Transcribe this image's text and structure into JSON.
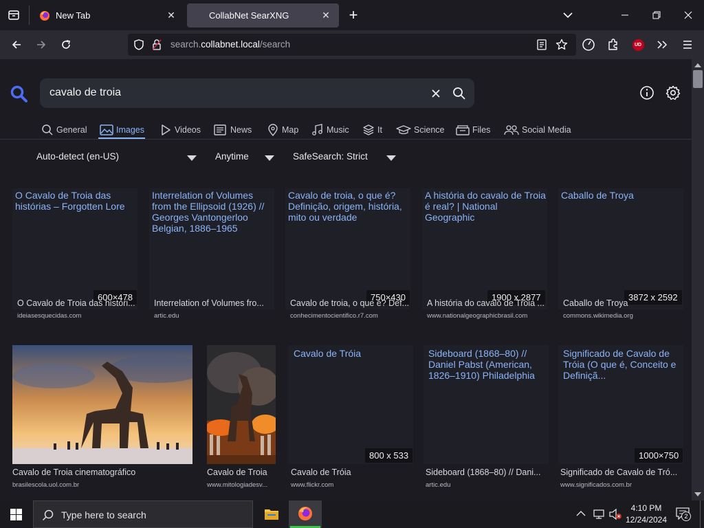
{
  "browser": {
    "tabs": [
      {
        "title": "New Tab",
        "active": false
      },
      {
        "title": "CollabNet SearXNG",
        "active": true
      }
    ],
    "url": {
      "domain_prefix": "search.",
      "domain": "collabnet.local",
      "path": "/search"
    },
    "ublock_badge": "UD"
  },
  "search": {
    "query": "cavalo de troia",
    "categories": [
      {
        "label": "General",
        "icon": "search-icon"
      },
      {
        "label": "Images",
        "icon": "image-icon",
        "active": true
      },
      {
        "label": "Videos",
        "icon": "play-icon"
      },
      {
        "label": "News",
        "icon": "newspaper-icon"
      },
      {
        "label": "Map",
        "icon": "map-pin-icon"
      },
      {
        "label": "Music",
        "icon": "music-icon"
      },
      {
        "label": "It",
        "icon": "layers-icon"
      },
      {
        "label": "Science",
        "icon": "graduation-cap-icon"
      },
      {
        "label": "Files",
        "icon": "files-icon"
      },
      {
        "label": "Social Media",
        "icon": "people-icon"
      }
    ],
    "filters": {
      "language": "Auto-detect (en-US)",
      "time": "Anytime",
      "safesearch": "SafeSearch: Strict"
    }
  },
  "results": [
    {
      "title": "O Cavalo de Troia das histórias – Forgotten Lore",
      "resolution": "600×478",
      "caption": "O Cavalo de Troia das históri...",
      "source": "ideiasesquecidas.com"
    },
    {
      "title": "Interrelation of Volumes from the Ellipsoid (1926) // Georges Vantongerloo Belgian, 1886–1965",
      "resolution": "",
      "caption": "Interrelation of Volumes fro...",
      "source": "artic.edu"
    },
    {
      "title": "Cavalo de troia, o que é? Definição, origem, história, mito ou verdade",
      "resolution": "750×430",
      "caption": "Cavalo de troia, o que é? Def...",
      "source": "conhecimentocientifico.r7.com"
    },
    {
      "title": "A história do cavalo de Troia é real? | National Geographic",
      "resolution": "1900 x 2877",
      "caption": "A história do cavalo de Troia ...",
      "source": "www.nationalgeographicbrasil.com"
    },
    {
      "title": "Caballo de Troya",
      "resolution": "3872 x 2592",
      "caption": "Caballo de Troya",
      "source": "commons.wikimedia.org"
    },
    {
      "title": "",
      "resolution": "",
      "caption": "Cavalo de Troia cinematográfico",
      "source": "brasilescola.uol.com.br"
    },
    {
      "title": "",
      "resolution": "",
      "caption": "Cavalo de Troia",
      "source": "www.mitologiadesv..."
    },
    {
      "title": "Cavalo de Tróia",
      "resolution": "800 x 533",
      "caption": "Cavalo de Tróia",
      "source": "www.flickr.com"
    },
    {
      "title": "Sideboard (1868–80) // Daniel Pabst (American, 1826–1910) Philadelphia",
      "resolution": "",
      "caption": "Sideboard (1868–80) // Dani...",
      "source": "artic.edu"
    },
    {
      "title": "Significado de Cavalo de Tróia (O que é, Conceito e Definiçã...",
      "resolution": "1000×750",
      "caption": "Significado de Cavalo de Tró...",
      "source": "www.significados.com.br"
    }
  ],
  "taskbar": {
    "search_placeholder": "Type here to search",
    "time": "4:10 PM",
    "date": "12/24/2024",
    "notification_count": "2"
  },
  "colors": {
    "accent": "#8ab4f8",
    "search_icon": "#4f6cf7",
    "ublock": "#c2001b",
    "firefox_active": "#3ec24b"
  }
}
